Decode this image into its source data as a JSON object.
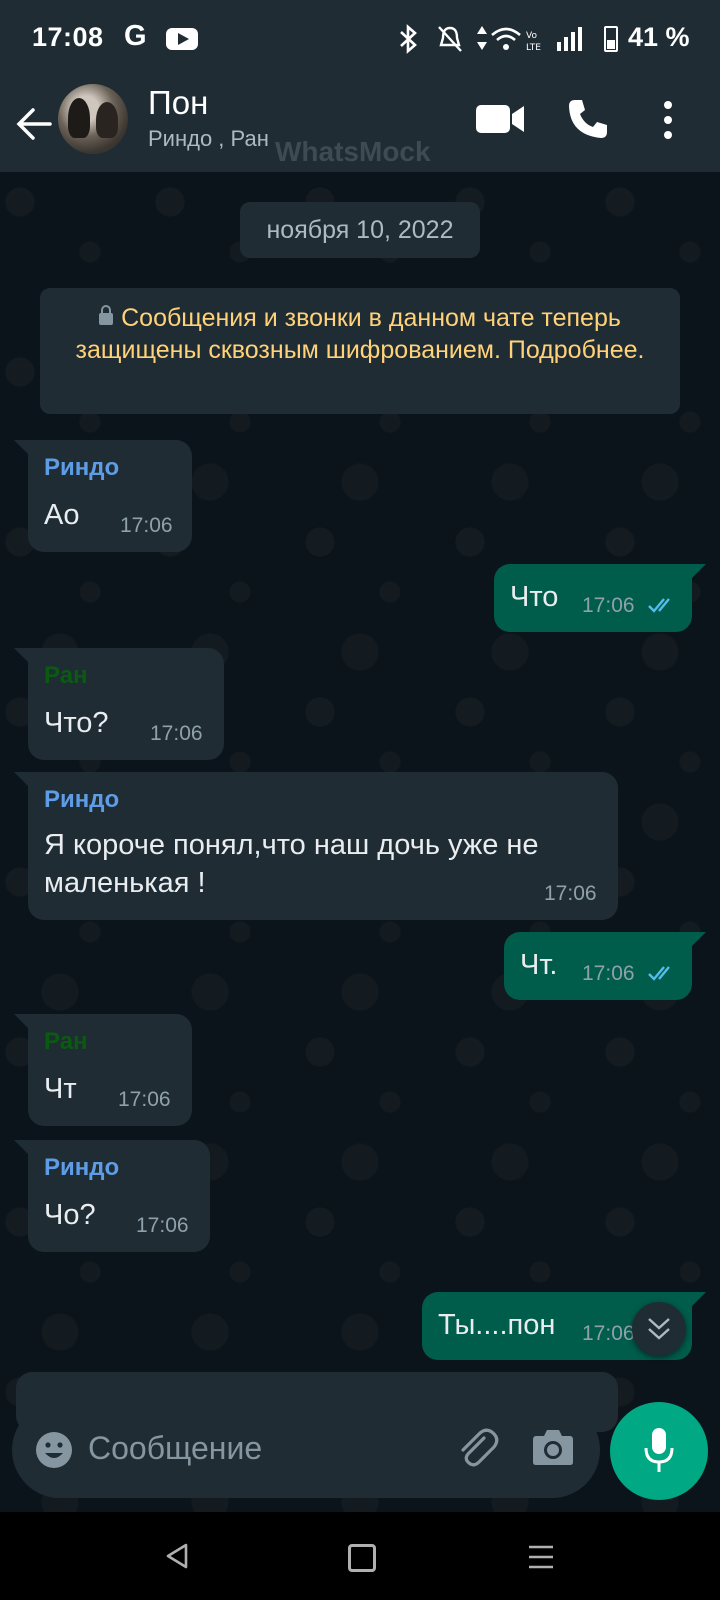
{
  "status_bar": {
    "time": "17:08",
    "g_label": "G",
    "battery_percent": "41 %",
    "icons": [
      "bluetooth-icon",
      "mute-icon",
      "data-icon",
      "wifi-icon",
      "volte-icon",
      "signal-icon",
      "battery-icon"
    ]
  },
  "header": {
    "chat_name": "Пон",
    "participants": "Риндо , Ран",
    "watermark": "WhatsMock",
    "icons": [
      "back-arrow-icon",
      "video-call-icon",
      "phone-icon",
      "more-icon"
    ]
  },
  "chat": {
    "date": "ноября 10, 2022",
    "encryption_notice": "Сообщения и звонки в данном чате теперь защищены сквозным шифрованием. Подробнее.",
    "messages": [
      {
        "direction": "in",
        "sender": "Риндо",
        "text": "Ао",
        "time": "17:06"
      },
      {
        "direction": "out",
        "text": "Что",
        "time": "17:06",
        "status": "read"
      },
      {
        "direction": "in",
        "sender": "Ран",
        "text": "Что?",
        "time": "17:06"
      },
      {
        "direction": "in",
        "sender": "Риндо",
        "text": "Я короче понял,что наш дочь уже не маленькая !",
        "time": "17:06"
      },
      {
        "direction": "out",
        "text": "Чт.",
        "time": "17:06",
        "status": "read"
      },
      {
        "direction": "in",
        "sender": "Ран",
        "text": "Чт",
        "time": "17:06"
      },
      {
        "direction": "in",
        "sender": "Риндо",
        "text": "Чо?",
        "time": "17:06"
      },
      {
        "direction": "out",
        "text": "Ты....пон",
        "time": "17:06",
        "status": "read"
      }
    ]
  },
  "input": {
    "placeholder": "Сообщение"
  },
  "colors": {
    "background": "#0b141a",
    "bar": "#1f2c34",
    "outgoing_bubble": "#005c4b",
    "incoming_bubble": "#1f2c34",
    "accent": "#00a884",
    "read_ticks": "#53bdeb",
    "encryption_text": "#ffd279",
    "sender_rindo": "#5e9de6",
    "sender_ran": "#0b5a12"
  }
}
